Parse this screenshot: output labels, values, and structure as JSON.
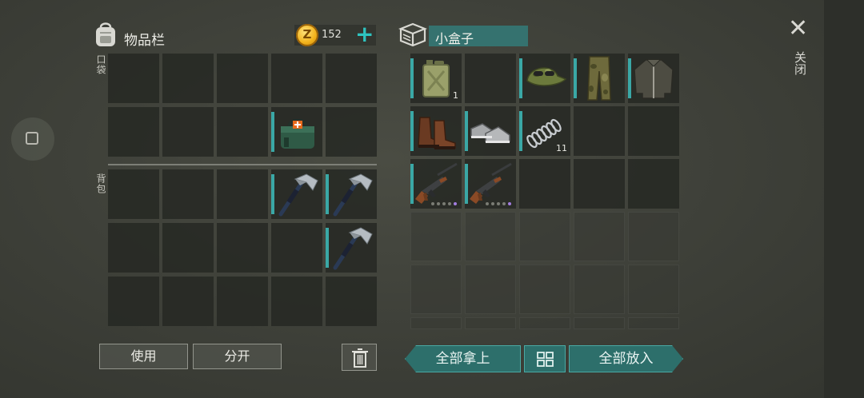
{
  "inventory": {
    "title": "物品栏",
    "coins": "152",
    "coin_symbol": "Z",
    "pockets_label": "口袋",
    "backpack_label": "背包",
    "use_button": "使用",
    "split_button": "分开",
    "pocket_items": [
      {
        "row": 1,
        "col": 3,
        "name": "medkit-bag-icon"
      }
    ],
    "backpack_items": [
      {
        "row": 0,
        "col": 3,
        "name": "hatchet-icon"
      },
      {
        "row": 0,
        "col": 4,
        "name": "hatchet-icon"
      },
      {
        "row": 1,
        "col": 4,
        "name": "hatchet-icon"
      }
    ]
  },
  "container": {
    "name": "小盒子",
    "items": [
      {
        "row": 0,
        "col": 0,
        "name": "jerrycan-icon",
        "count": "1"
      },
      {
        "row": 0,
        "col": 2,
        "name": "camo-cap-icon"
      },
      {
        "row": 0,
        "col": 3,
        "name": "camo-pants-icon"
      },
      {
        "row": 0,
        "col": 4,
        "name": "jacket-icon"
      },
      {
        "row": 1,
        "col": 0,
        "name": "leather-boots-icon"
      },
      {
        "row": 1,
        "col": 1,
        "name": "sneakers-icon"
      },
      {
        "row": 1,
        "col": 2,
        "name": "spring-icon",
        "count": "11"
      },
      {
        "row": 2,
        "col": 0,
        "name": "assault-rifle-icon"
      },
      {
        "row": 2,
        "col": 1,
        "name": "assault-rifle-icon"
      }
    ],
    "take_all_button": "全部拿上",
    "put_all_button": "全部放入"
  },
  "close_label": "关闭",
  "colors": {
    "accent": "#2ec4c0",
    "teal_button": "#2d6f6b",
    "coin": "#f2b21b"
  }
}
